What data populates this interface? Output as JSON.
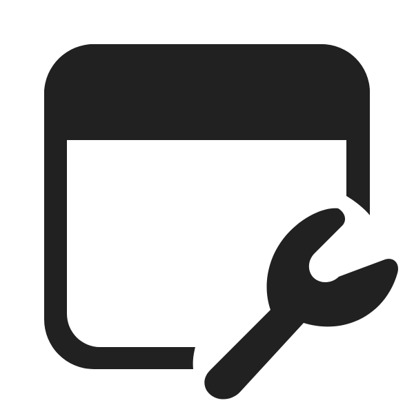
{
  "icon": {
    "name": "window-wrench-icon",
    "glyph_color": "#212121",
    "background_color": "#ffffff"
  }
}
